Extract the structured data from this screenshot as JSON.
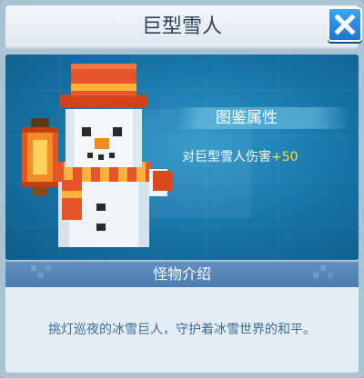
{
  "dialog": {
    "title": "巨型雪人",
    "close_icon": "close-icon"
  },
  "attributes": {
    "heading": "图鉴属性",
    "stat_label": "对巨型雪人伤害",
    "stat_value": "+50"
  },
  "monster_intro": {
    "heading": "怪物介绍",
    "description": "挑灯巡夜的冰雪巨人，守护着冰雪世界的和平。"
  },
  "colors": {
    "showcase_blue": "#1673a6",
    "stat_value_yellow": "#f4e03b",
    "close_button_blue": "#1d76cf",
    "title_text": "#2b4259"
  }
}
